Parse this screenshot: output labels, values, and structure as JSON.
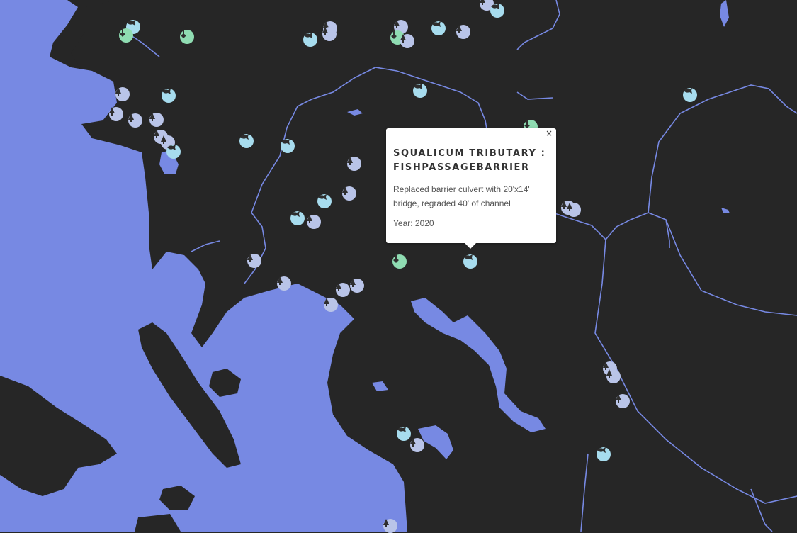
{
  "map": {
    "colors": {
      "land": "#262626",
      "water": "#7789e3",
      "fish_marker": "#a7dcee",
      "tree_marker": "#b9c4e8",
      "shovel_marker": "#8fdcb2"
    },
    "marker_types": [
      "fish-icon",
      "tree-icon",
      "shovel-icon"
    ]
  },
  "popup": {
    "close_label": "×",
    "title": "SQUALICUM TRIBUTARY : FISHPASSAGEBARRIER",
    "description": "Replaced barrier culvert with 20'x14' bridge, regraded 40' of channel",
    "year": "Year: 2020"
  }
}
